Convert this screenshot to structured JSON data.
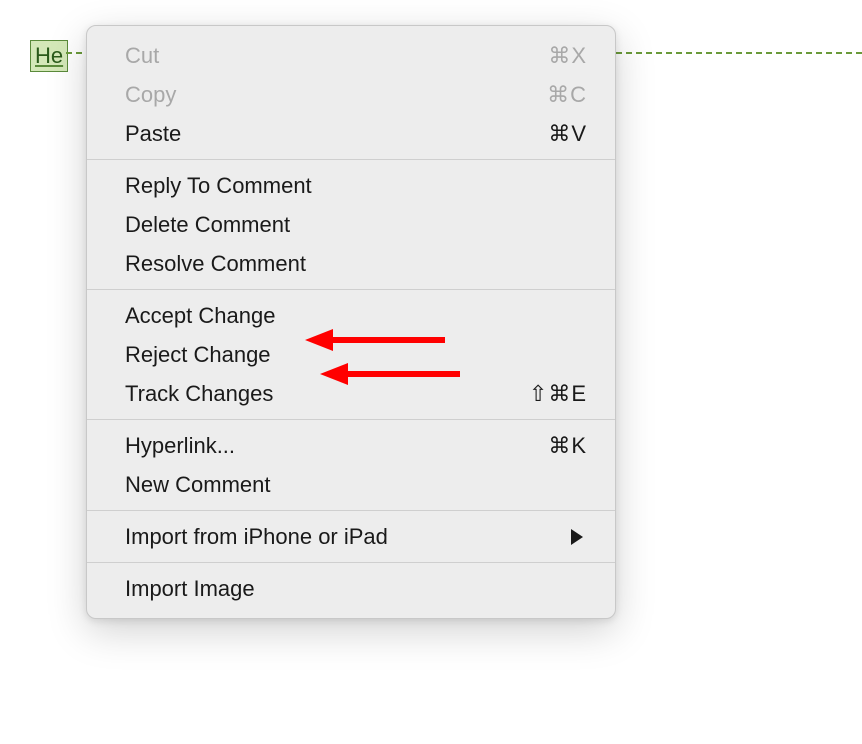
{
  "document": {
    "highlighted_text": "He"
  },
  "contextMenu": {
    "sections": [
      {
        "items": [
          {
            "label": "Cut",
            "shortcut": "⌘X",
            "disabled": true
          },
          {
            "label": "Copy",
            "shortcut": "⌘C",
            "disabled": true
          },
          {
            "label": "Paste",
            "shortcut": "⌘V",
            "disabled": false
          }
        ]
      },
      {
        "items": [
          {
            "label": "Reply To Comment",
            "disabled": false
          },
          {
            "label": "Delete Comment",
            "disabled": false
          },
          {
            "label": "Resolve Comment",
            "disabled": false
          }
        ]
      },
      {
        "items": [
          {
            "label": "Accept Change",
            "disabled": false
          },
          {
            "label": "Reject Change",
            "disabled": false
          },
          {
            "label": "Track Changes",
            "shortcut": "⇧⌘E",
            "disabled": false
          }
        ]
      },
      {
        "items": [
          {
            "label": "Hyperlink...",
            "shortcut": "⌘K",
            "disabled": false
          },
          {
            "label": "New Comment",
            "disabled": false
          }
        ]
      },
      {
        "items": [
          {
            "label": "Import from iPhone or iPad",
            "submenu": true,
            "disabled": false
          }
        ]
      },
      {
        "items": [
          {
            "label": "Import Image",
            "disabled": false
          }
        ]
      }
    ]
  }
}
